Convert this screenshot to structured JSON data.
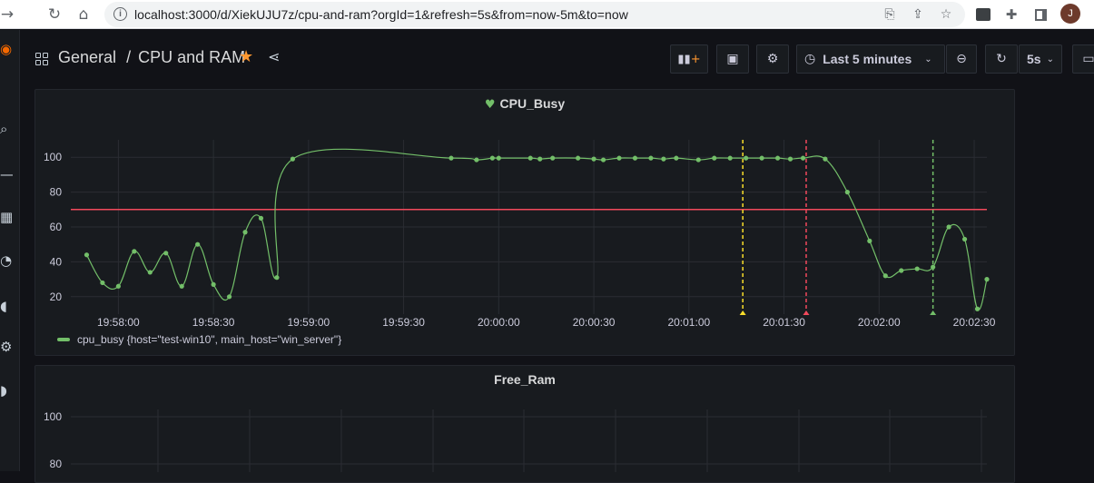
{
  "browser": {
    "url": "localhost:3000/d/XiekUJU7z/cpu-and-ram?orgId=1&refresh=5s&from=now-5m&to=now",
    "avatar_letter": "J",
    "icons": [
      "back-arrow-icon",
      "forward-arrow-icon",
      "reload-icon",
      "home-icon",
      "site-info-icon",
      "translate-icon",
      "share-icon",
      "bookmark-star-icon",
      "extension-icon",
      "puzzle-icon",
      "sidepanel-icon"
    ]
  },
  "header": {
    "folder": "General",
    "separator": "/",
    "title": "CPU and RAM",
    "time_range": "Last 5 minutes",
    "refresh_interval": "5s"
  },
  "colors": {
    "background": "#111217",
    "panel": "#181b1f",
    "series": "#73bf69",
    "threshold": "#f2495c",
    "annotation_yellow": "#fade2a",
    "annotation_red": "#f2495c",
    "annotation_green": "#73bf69",
    "star": "#ff9830"
  },
  "panels": {
    "cpu": {
      "title": "CPU_Busy",
      "health_icon": "heart-icon",
      "legend": "cpu_busy {host=\"test-win10\", main_host=\"win_server\"}"
    },
    "ram": {
      "title": "Free_Ram"
    }
  },
  "chart_data": [
    {
      "type": "line",
      "title": "CPU_Busy",
      "xlabel": "",
      "ylabel": "",
      "x_ticks": [
        "19:58:00",
        "19:58:30",
        "19:59:00",
        "19:59:30",
        "20:00:00",
        "20:00:30",
        "20:01:00",
        "20:01:30",
        "20:02:00",
        "20:02:30"
      ],
      "y_ticks": [
        20,
        40,
        60,
        80,
        100
      ],
      "ylim": [
        10,
        110
      ],
      "xlim": [
        "19:57:45",
        "20:02:34"
      ],
      "grid": true,
      "legend_position": "bottom-left",
      "threshold": 70,
      "annotations": [
        {
          "x": "20:01:17",
          "color": "yellow"
        },
        {
          "x": "20:01:37",
          "color": "red"
        },
        {
          "x": "20:02:17",
          "color": "green"
        }
      ],
      "series": [
        {
          "name": "cpu_busy {host=\"test-win10\", main_host=\"win_server\"}",
          "x": [
            "19:57:50",
            "19:57:55",
            "19:58:00",
            "19:58:05",
            "19:58:10",
            "19:58:15",
            "19:58:20",
            "19:58:25",
            "19:58:30",
            "19:58:35",
            "19:58:40",
            "19:58:45",
            "19:58:50",
            "19:58:55",
            "19:59:00",
            "19:59:05",
            "19:59:10",
            "19:59:15",
            "19:59:20",
            "19:59:25",
            "19:59:30",
            "19:59:35",
            "19:59:40",
            "19:59:45",
            "19:59:50",
            "19:59:55",
            "20:00:00",
            "20:00:05",
            "20:00:10",
            "20:00:15",
            "20:00:20",
            "20:00:25",
            "20:00:30",
            "20:00:35",
            "20:00:40",
            "20:00:45",
            "20:00:50",
            "20:00:55",
            "20:01:00",
            "20:01:05",
            "20:01:10",
            "20:01:15",
            "20:01:20",
            "20:01:25",
            "20:01:30",
            "20:01:35",
            "20:01:40",
            "20:01:45",
            "20:01:50",
            "20:01:55",
            "20:02:00",
            "20:02:05",
            "20:02:10",
            "20:02:15",
            "20:02:20",
            "20:02:25",
            "20:02:30",
            "20:02:34"
          ],
          "y": [
            44,
            28,
            26,
            46,
            34,
            45,
            26,
            50,
            27,
            20,
            57,
            65,
            31,
            99,
            99,
            99,
            99,
            99,
            99,
            99,
            99,
            99,
            99,
            99,
            98,
            99,
            99,
            99,
            99,
            98,
            99,
            99,
            99,
            98,
            99,
            99,
            99,
            99,
            98,
            99,
            99,
            99,
            99,
            99,
            99,
            98,
            80,
            52,
            32,
            35,
            36,
            37,
            60,
            53,
            13,
            30,
            30,
            30
          ],
          "points": [
            [
              "19:57:50",
              44
            ],
            [
              "19:57:55",
              28
            ],
            [
              "19:58:00",
              26
            ],
            [
              "19:58:05",
              46
            ],
            [
              "19:58:10",
              34
            ],
            [
              "19:58:15",
              45
            ],
            [
              "19:58:20",
              26
            ],
            [
              "19:58:25",
              50
            ],
            [
              "19:58:30",
              27
            ],
            [
              "19:58:35",
              20
            ],
            [
              "19:58:40",
              57
            ],
            [
              "19:58:45",
              65
            ],
            [
              "19:58:50",
              31
            ],
            [
              "19:58:55",
              99
            ],
            [
              "19:59:45",
              99.5
            ],
            [
              "19:59:53",
              98.5
            ],
            [
              "19:59:58",
              99.5
            ],
            [
              "20:00:00",
              99.5
            ],
            [
              "20:00:10",
              99.5
            ],
            [
              "20:00:13",
              99
            ],
            [
              "20:00:17",
              99.5
            ],
            [
              "20:00:25",
              99.5
            ],
            [
              "20:00:30",
              99
            ],
            [
              "20:00:33",
              98.5
            ],
            [
              "20:00:38",
              99.5
            ],
            [
              "20:00:43",
              99.5
            ],
            [
              "20:00:48",
              99.5
            ],
            [
              "20:00:52",
              99
            ],
            [
              "20:00:56",
              99.5
            ],
            [
              "20:01:03",
              98.5
            ],
            [
              "20:01:08",
              99.5
            ],
            [
              "20:01:13",
              99.5
            ],
            [
              "20:01:18",
              99.5
            ],
            [
              "20:01:23",
              99.5
            ],
            [
              "20:01:28",
              99.5
            ],
            [
              "20:01:32",
              99
            ],
            [
              "20:01:36",
              99.5
            ],
            [
              "20:01:43",
              99
            ],
            [
              "20:01:50",
              80
            ],
            [
              "20:01:57",
              52
            ],
            [
              "20:02:02",
              32
            ],
            [
              "20:02:07",
              35
            ],
            [
              "20:02:12",
              36
            ],
            [
              "20:02:17",
              37
            ],
            [
              "20:02:22",
              60
            ],
            [
              "20:02:27",
              53
            ],
            [
              "20:02:31",
              13
            ],
            [
              "20:02:34",
              30
            ]
          ]
        }
      ]
    },
    {
      "type": "line",
      "title": "Free_Ram",
      "xlabel": "",
      "ylabel": "",
      "y_ticks": [
        80,
        100
      ],
      "grid": true,
      "series": []
    }
  ]
}
